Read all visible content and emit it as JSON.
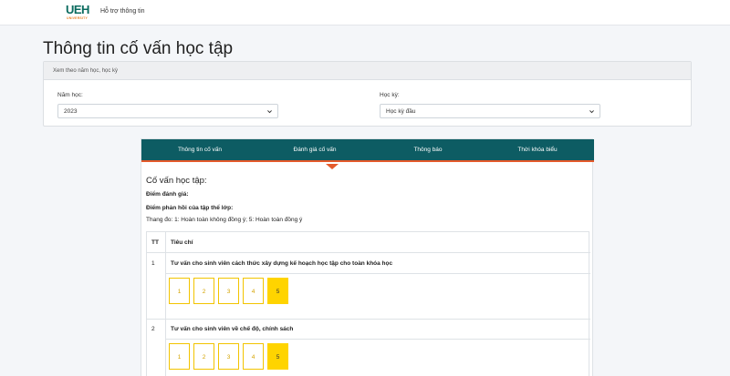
{
  "navbar": {
    "logo_text": "UEH",
    "logo_sub": "UNIVERSITY",
    "link_support": "Hỗ trợ thông tin"
  },
  "page": {
    "title": "Thông tin cố vấn học tập"
  },
  "filter": {
    "header": "Xem theo năm học, học kỳ",
    "year_label": "Năm học:",
    "year_value": "2023",
    "term_label": "Học kỳ:",
    "term_value": "Học kỳ đầu"
  },
  "tabs": [
    {
      "label": "Thông tin cố vấn"
    },
    {
      "label": "Đánh giá cố vấn"
    },
    {
      "label": "Thông báo"
    },
    {
      "label": "Thời khóa biểu"
    }
  ],
  "evaluation": {
    "adviser_title": "Cố vấn học tập:",
    "score_label": "Điểm đánh giá:",
    "feedback_label": "Điểm phản hồi của tập thể lớp:",
    "scale_note": "Thang đo: 1: Hoàn toàn không đồng ý; 5: Hoàn toàn đồng ý"
  },
  "table": {
    "col_tt": "TT",
    "col_criteria": "Tiêu chí",
    "rows": [
      {
        "tt": "1",
        "criteria": "Tư vấn cho sinh viên cách thức xây dựng kế hoạch học tập cho toàn khóa học",
        "ratings": [
          "1",
          "2",
          "3",
          "4",
          "5"
        ],
        "selected": 5
      },
      {
        "tt": "2",
        "criteria": "Tư vấn cho sinh viên về chế độ, chính sách",
        "ratings": [
          "1",
          "2",
          "3",
          "4",
          "5"
        ],
        "selected": 5
      }
    ]
  },
  "colors": {
    "tab_bar": "#0d5c63",
    "accent": "#e55a2b",
    "rating_selected": "#ffd400",
    "logo_green": "#0a6b5f"
  }
}
